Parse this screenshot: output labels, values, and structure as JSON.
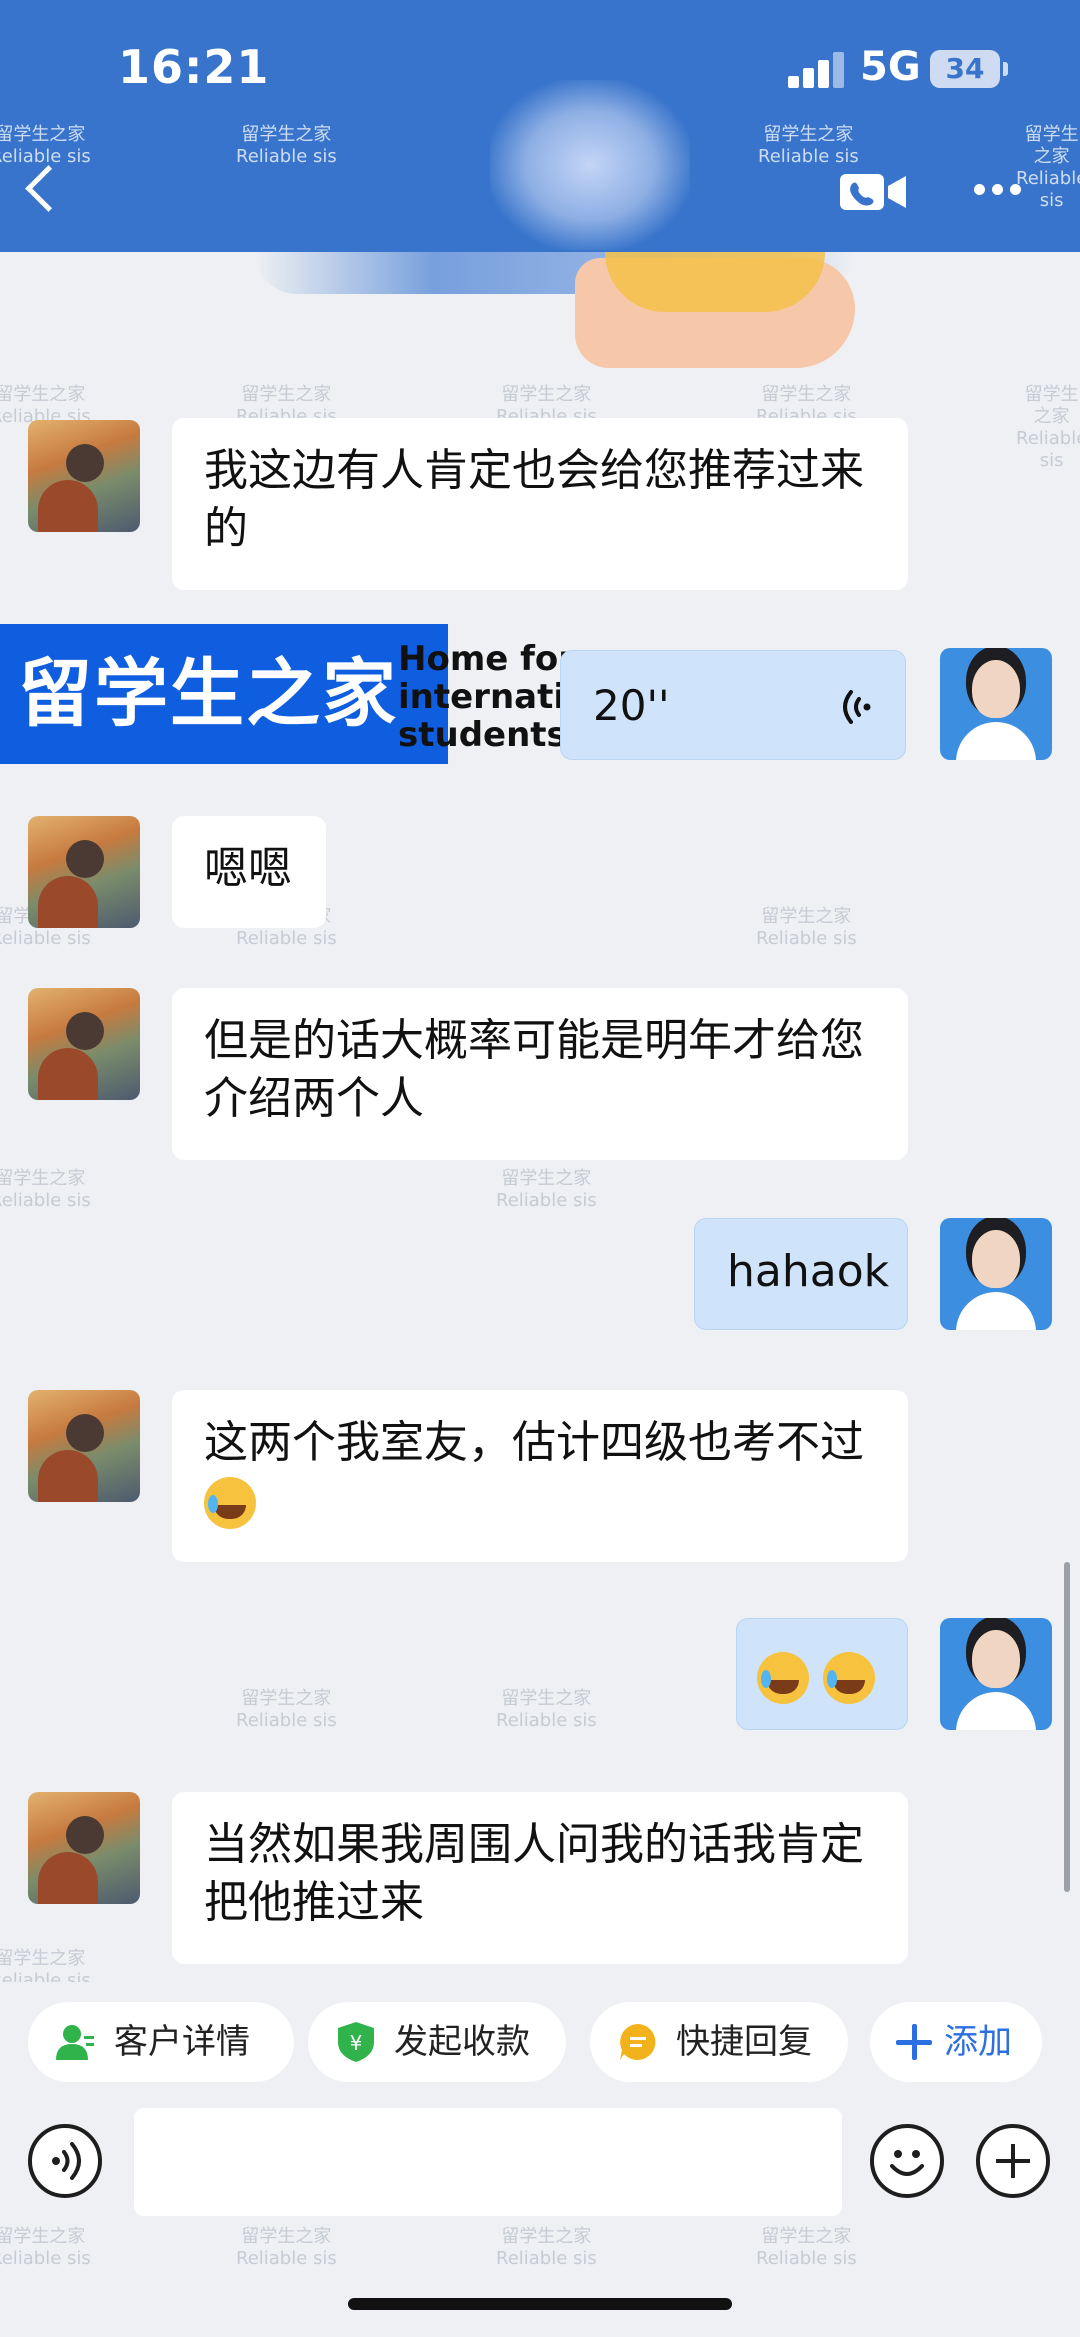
{
  "status_bar": {
    "time": "16:21",
    "network": "5G",
    "battery": "34"
  },
  "header": {
    "watermarks": [
      {
        "cn": "留学生之家",
        "en": "Reliable sis"
      },
      {
        "cn": "留学生之家",
        "en": "Reliable sis"
      },
      {
        "cn": "留学生之家",
        "en": "Reliable sis"
      },
      {
        "cn": "留学生之家",
        "en": "Reliable sis"
      }
    ]
  },
  "messages": [
    {
      "side": "in",
      "text": "我这边有人肯定也会给您推荐过来的"
    },
    {
      "side": "out",
      "type": "voice",
      "duration": "20''"
    },
    {
      "side": "in",
      "text": "嗯嗯"
    },
    {
      "side": "in",
      "text": "但是的话大概率可能是明年才给您介绍两个人"
    },
    {
      "side": "out",
      "text": "hahaok"
    },
    {
      "side": "in",
      "text": "这两个我室友，估计四级也考不过"
    },
    {
      "side": "out",
      "type": "emoji"
    },
    {
      "side": "in",
      "text": "当然如果我周围人问我的话我肯定把他推过来"
    }
  ],
  "banner": {
    "cn": "留学生之家",
    "en_lines": [
      "Home for",
      "international",
      "students"
    ]
  },
  "chat_watermark": {
    "cn": "留学生之家",
    "en": "Reliable sis"
  },
  "quick_actions": [
    {
      "label": "客户详情",
      "icon": "user-detail-icon",
      "color": "#2fb34a"
    },
    {
      "label": "发起收款",
      "icon": "yuan-shield-icon",
      "color": "#2fb34a"
    },
    {
      "label": "快捷回复",
      "icon": "quick-reply-icon",
      "color": "#f2b21b"
    },
    {
      "label": "添加",
      "icon": "plus-icon",
      "color": "#2c6fe0"
    }
  ],
  "input": {
    "placeholder": ""
  },
  "colors": {
    "header": "#3874cb",
    "bubble_out": "#cfe4fb",
    "bubble_in": "#ffffff",
    "banner": "#0f5ee0"
  }
}
